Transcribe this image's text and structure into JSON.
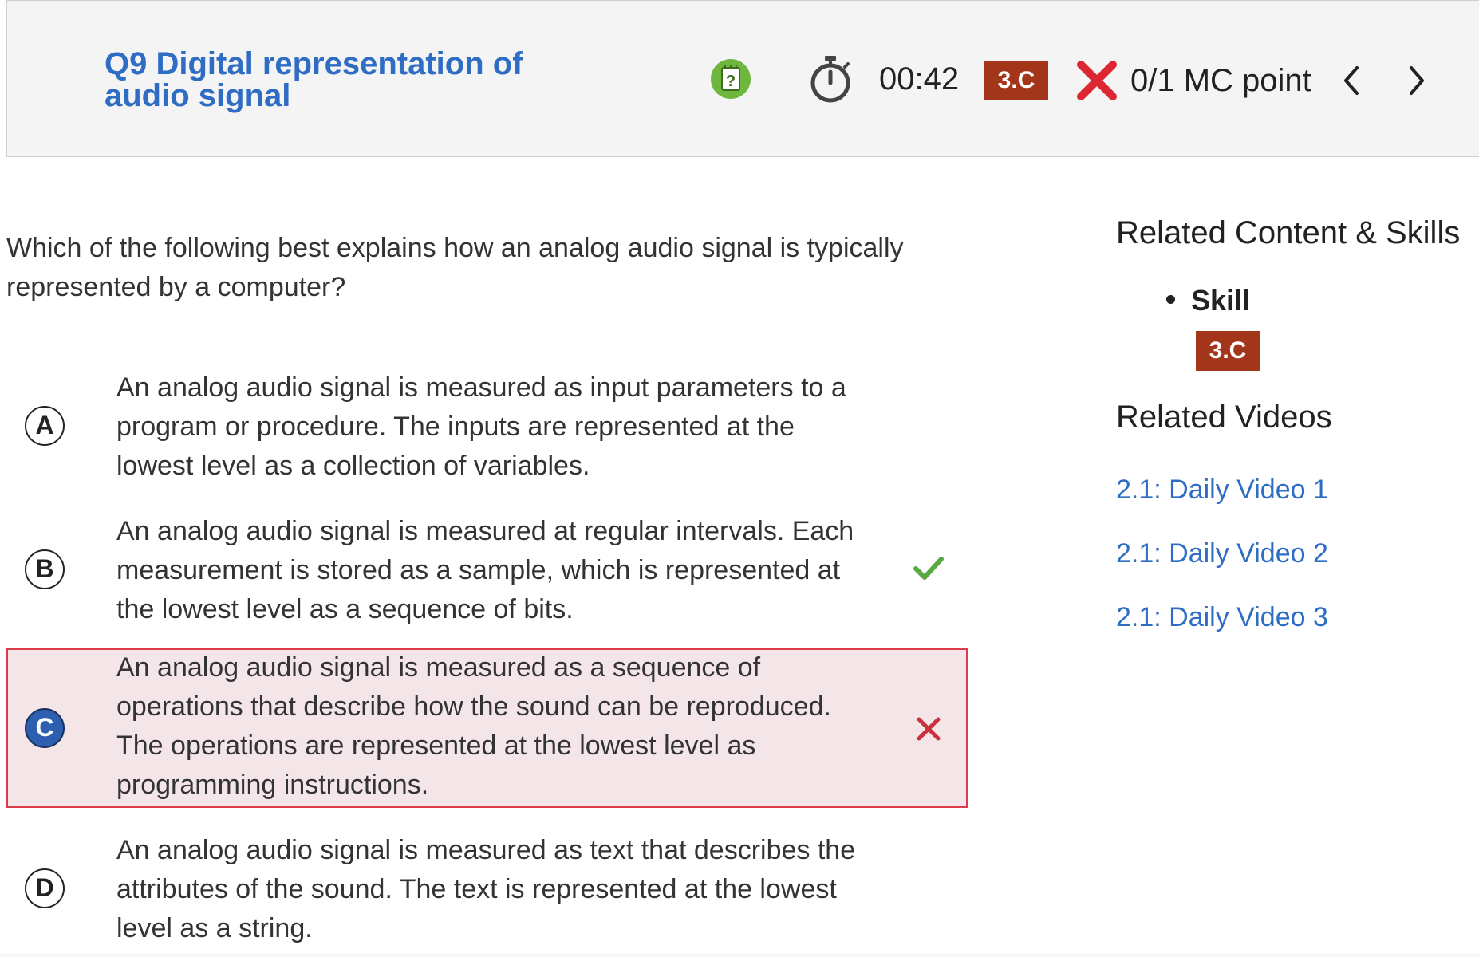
{
  "header": {
    "question_title": "Q9 Digital representation of audio signal",
    "hint_icon": "question-notepad-icon",
    "timer_icon": "stopwatch-icon",
    "timer": "00:42",
    "skill_badge": "3.C",
    "result_icon": "red-x-icon",
    "score": "0/1 MC point",
    "prev_icon": "chevron-left-icon",
    "next_icon": "chevron-right-icon"
  },
  "question": {
    "text": "Which of the following best explains how an analog audio signal is typically represented by a computer?"
  },
  "choices": [
    {
      "letter": "A",
      "text": "An analog audio signal is measured as input parameters to a program or procedure. The inputs are represented at the lowest level as a collection of variables.",
      "selected": false,
      "mark": ""
    },
    {
      "letter": "B",
      "text": "An analog audio signal is measured at regular intervals. Each measurement is stored as a sample, which is represented at the lowest level as a sequence of bits.",
      "selected": false,
      "mark": "check-icon"
    },
    {
      "letter": "C",
      "text": "An analog audio signal is measured as a sequence of operations that describe how the sound can be reproduced. The operations are represented at the lowest level as programming instructions.",
      "selected": true,
      "mark": "x-icon"
    },
    {
      "letter": "D",
      "text": "An analog audio signal is measured as text that describes the attributes of the sound. The text is represented at the lowest level as a string.",
      "selected": false,
      "mark": ""
    }
  ],
  "sidebar": {
    "related_title": "Related Content & Skills",
    "skill_label": "Skill",
    "skill_badge": "3.C",
    "videos_title": "Related Videos",
    "videos": [
      "2.1: Daily Video 1",
      "2.1: Daily Video 2",
      "2.1: Daily Video 3"
    ]
  },
  "colors": {
    "title_blue": "#2f6dc4",
    "badge_red": "#a3351a",
    "error_red": "#dc3c4c",
    "correct_green": "#5aa843",
    "selected_bg": "#f4e6e8",
    "selected_circle": "#2c5fb0"
  }
}
